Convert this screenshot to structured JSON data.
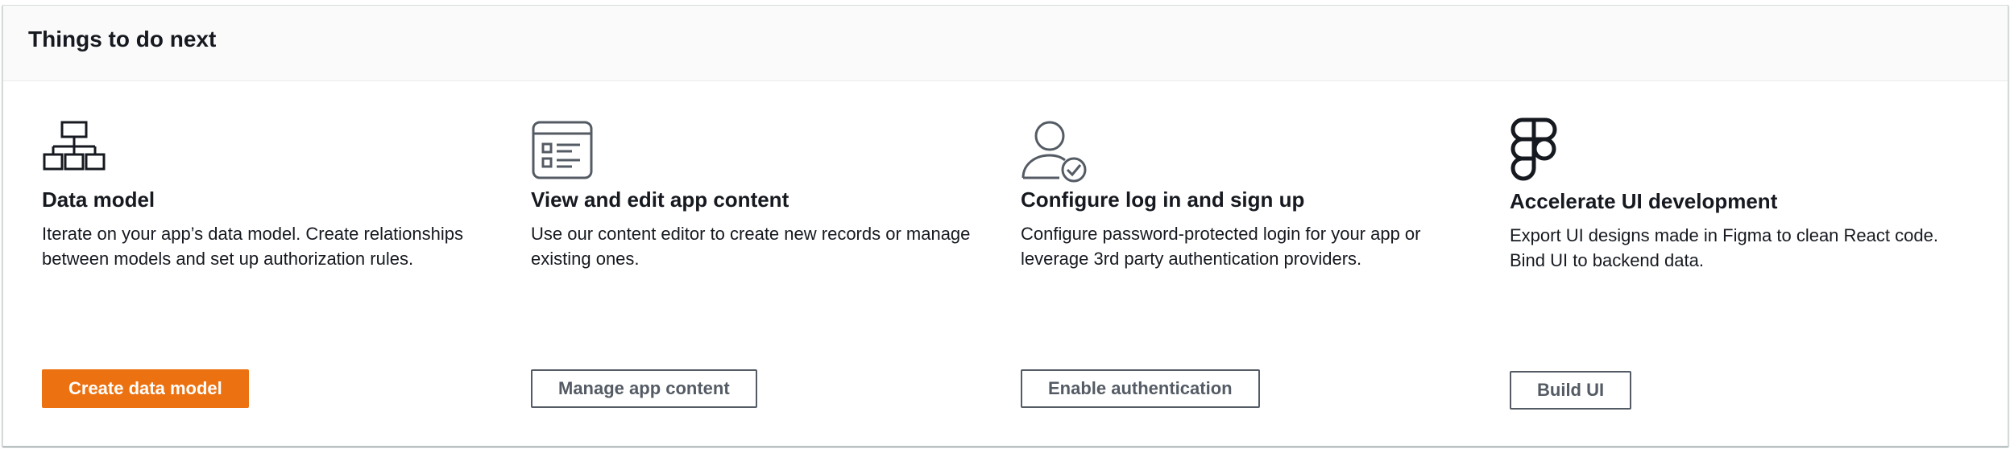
{
  "panel": {
    "title": "Things to do next"
  },
  "cards": [
    {
      "icon": "hierarchy-icon",
      "title": "Data model",
      "description": "Iterate on your app’s data model. Create relationships between models and set up authorization rules.",
      "button_label": "Create data model"
    },
    {
      "icon": "content-list-icon",
      "title": "View and edit app content",
      "description": "Use our content editor to create new records or manage existing ones.",
      "button_label": "Manage app content"
    },
    {
      "icon": "user-check-icon",
      "title": "Configure log in and sign up",
      "description": "Configure password-protected login for your app or leverage 3rd party authentication providers.",
      "button_label": "Enable authentication"
    },
    {
      "icon": "figma-logo-icon",
      "title": "Accelerate UI development",
      "description": "Export UI designs made in Figma to clean React code. Bind UI to backend data.",
      "button_label": "Build UI"
    }
  ],
  "colors": {
    "primary_button": "#ec7211",
    "text": "#16191f",
    "secondary_border": "#545b64"
  }
}
